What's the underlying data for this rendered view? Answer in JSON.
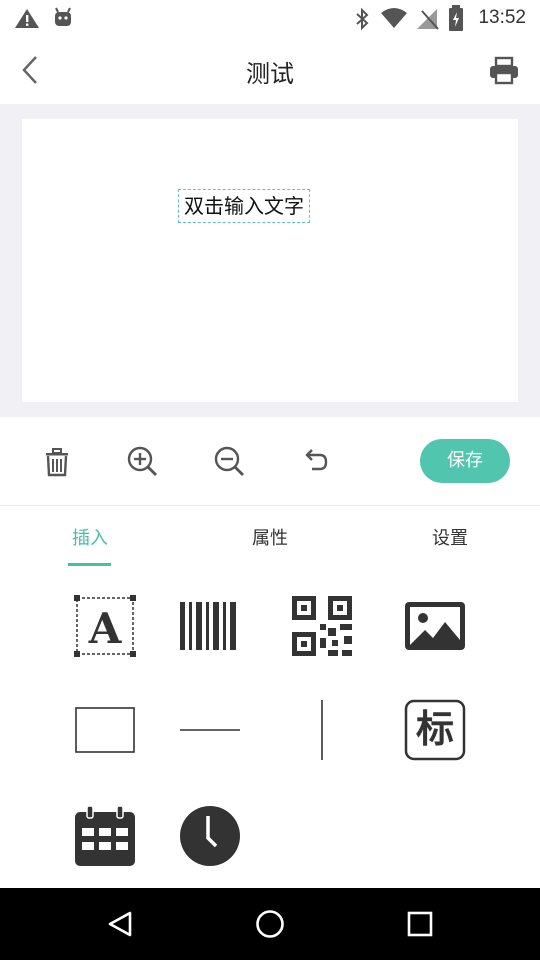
{
  "status_bar": {
    "time": "13:52"
  },
  "header": {
    "title": "测试"
  },
  "canvas": {
    "text_element": "双击输入文字"
  },
  "toolbar": {
    "save_label": "保存"
  },
  "tabs": [
    {
      "label": "插入",
      "active": true
    },
    {
      "label": "属性",
      "active": false
    },
    {
      "label": "设置",
      "active": false
    }
  ],
  "insert_items": [
    {
      "icon": "text-icon"
    },
    {
      "icon": "barcode-icon"
    },
    {
      "icon": "qrcode-icon"
    },
    {
      "icon": "image-icon"
    },
    {
      "icon": "rectangle-icon"
    },
    {
      "icon": "horizontal-line-icon"
    },
    {
      "icon": "vertical-line-icon"
    },
    {
      "icon": "logo-icon",
      "glyph": "标"
    },
    {
      "icon": "calendar-icon"
    },
    {
      "icon": "clock-icon"
    }
  ],
  "colors": {
    "accent": "#51c5ad",
    "tab_active": "#45bfa6",
    "canvas_bg": "#f1f1f5"
  }
}
